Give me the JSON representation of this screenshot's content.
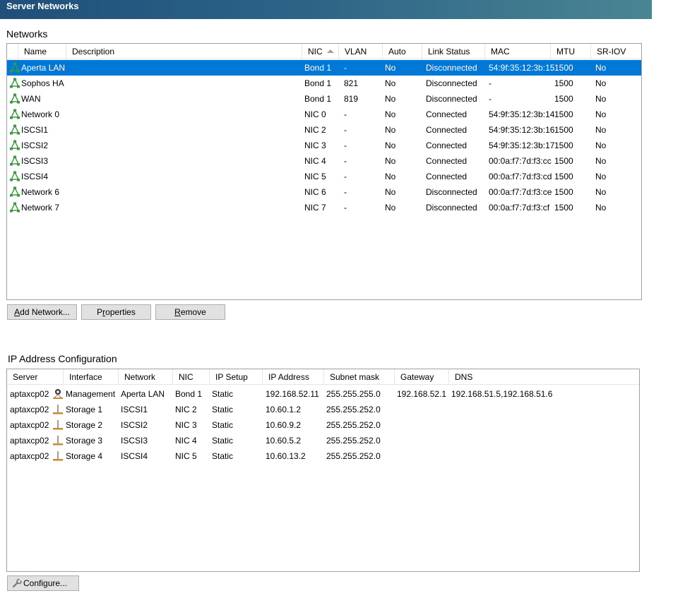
{
  "window": {
    "title": "Server Networks"
  },
  "networks": {
    "section_title": "Networks",
    "columns": {
      "name": "Name",
      "description": "Description",
      "nic": "NIC",
      "vlan": "VLAN",
      "auto": "Auto",
      "link_status": "Link Status",
      "mac": "MAC",
      "mtu": "MTU",
      "sriov": "SR-IOV"
    },
    "sorted_column": "nic",
    "selected_index": 0,
    "rows": [
      {
        "name": "Aperta LAN",
        "description": "",
        "nic": "Bond 1",
        "vlan": "-",
        "auto": "No",
        "link_status": "Disconnected",
        "mac": "54:9f:35:12:3b:15",
        "mtu": "1500",
        "sriov": "No"
      },
      {
        "name": "Sophos HA",
        "description": "",
        "nic": "Bond 1",
        "vlan": "821",
        "auto": "No",
        "link_status": "Disconnected",
        "mac": "-",
        "mtu": "1500",
        "sriov": "No"
      },
      {
        "name": "WAN",
        "description": "",
        "nic": "Bond 1",
        "vlan": "819",
        "auto": "No",
        "link_status": "Disconnected",
        "mac": "-",
        "mtu": "1500",
        "sriov": "No"
      },
      {
        "name": "Network 0",
        "description": "",
        "nic": "NIC 0",
        "vlan": "-",
        "auto": "No",
        "link_status": "Connected",
        "mac": "54:9f:35:12:3b:14",
        "mtu": "1500",
        "sriov": "No"
      },
      {
        "name": "ISCSI1",
        "description": "",
        "nic": "NIC 2",
        "vlan": "-",
        "auto": "No",
        "link_status": "Connected",
        "mac": "54:9f:35:12:3b:16",
        "mtu": "1500",
        "sriov": "No"
      },
      {
        "name": "ISCSI2",
        "description": "",
        "nic": "NIC 3",
        "vlan": "-",
        "auto": "No",
        "link_status": "Connected",
        "mac": "54:9f:35:12:3b:17",
        "mtu": "1500",
        "sriov": "No"
      },
      {
        "name": "ISCSI3",
        "description": "",
        "nic": "NIC 4",
        "vlan": "-",
        "auto": "No",
        "link_status": "Connected",
        "mac": "00:0a:f7:7d:f3:cc",
        "mtu": "1500",
        "sriov": "No"
      },
      {
        "name": "ISCSI4",
        "description": "",
        "nic": "NIC 5",
        "vlan": "-",
        "auto": "No",
        "link_status": "Connected",
        "mac": "00:0a:f7:7d:f3:cd",
        "mtu": "1500",
        "sriov": "No"
      },
      {
        "name": "Network 6",
        "description": "",
        "nic": "NIC 6",
        "vlan": "-",
        "auto": "No",
        "link_status": "Disconnected",
        "mac": "00:0a:f7:7d:f3:ce",
        "mtu": "1500",
        "sriov": "No"
      },
      {
        "name": "Network 7",
        "description": "",
        "nic": "NIC 7",
        "vlan": "-",
        "auto": "No",
        "link_status": "Disconnected",
        "mac": "00:0a:f7:7d:f3:cf",
        "mtu": "1500",
        "sriov": "No"
      }
    ],
    "buttons": {
      "add": "Add Network...",
      "properties": "Properties",
      "remove": "Remove"
    },
    "icon": "network-icon",
    "icon_color": "#3c9a3c"
  },
  "ip_config": {
    "section_title": "IP Address Configuration",
    "columns": {
      "server": "Server",
      "interface": "Interface",
      "network": "Network",
      "nic": "NIC",
      "ip_setup": "IP Setup",
      "ip_address": "IP Address",
      "subnet": "Subnet mask",
      "gateway": "Gateway",
      "dns": "DNS"
    },
    "rows": [
      {
        "server": "aptaxcp02",
        "interface": "Management",
        "icon": "management-icon",
        "network": "Aperta LAN",
        "nic": "Bond 1",
        "ip_setup": "Static",
        "ip_address": "192.168.52.11",
        "subnet": "255.255.255.0",
        "gateway": "192.168.52.1",
        "dns": "192.168.51.5,192.168.51.6"
      },
      {
        "server": "aptaxcp02",
        "interface": "Storage 1",
        "icon": "storage-icon",
        "network": "ISCSI1",
        "nic": "NIC 2",
        "ip_setup": "Static",
        "ip_address": "10.60.1.2",
        "subnet": "255.255.252.0",
        "gateway": "",
        "dns": ""
      },
      {
        "server": "aptaxcp02",
        "interface": "Storage 2",
        "icon": "storage-icon",
        "network": "ISCSI2",
        "nic": "NIC 3",
        "ip_setup": "Static",
        "ip_address": "10.60.9.2",
        "subnet": "255.255.252.0",
        "gateway": "",
        "dns": ""
      },
      {
        "server": "aptaxcp02",
        "interface": "Storage 3",
        "icon": "storage-icon",
        "network": "ISCSI3",
        "nic": "NIC 4",
        "ip_setup": "Static",
        "ip_address": "10.60.5.2",
        "subnet": "255.255.252.0",
        "gateway": "",
        "dns": ""
      },
      {
        "server": "aptaxcp02",
        "interface": "Storage 4",
        "icon": "storage-icon",
        "network": "ISCSI4",
        "nic": "NIC 5",
        "ip_setup": "Static",
        "ip_address": "10.60.13.2",
        "subnet": "255.255.252.0",
        "gateway": "",
        "dns": ""
      }
    ],
    "buttons": {
      "configure": "Configure...",
      "configure_icon": "wrench-icon"
    }
  },
  "colors": {
    "selection": "#0078d7",
    "title_gradient_start": "#1f4f7a",
    "title_gradient_end": "#4a8593"
  }
}
